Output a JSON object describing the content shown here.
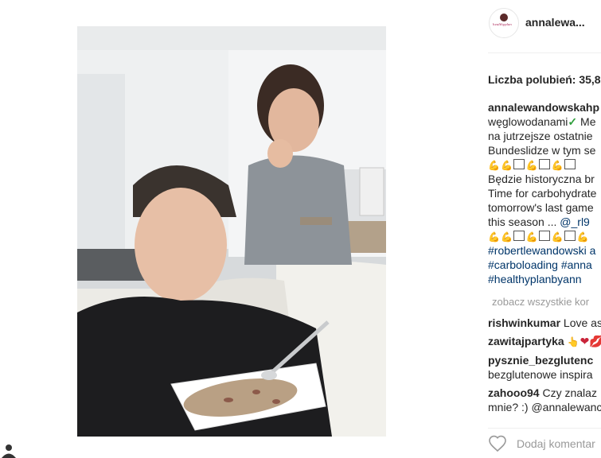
{
  "post": {
    "username": "annalewa...",
    "likes_label": "Liczba polubień: 35,8",
    "caption": {
      "author": "annalewandowskahp",
      "l1b": "węglowodanami",
      "l1c": "Me",
      "l2": "na jutrzejsze ostatnie",
      "l3": "Bundeslidze w tym se",
      "l5": "Będzie historyczna br",
      "l6": "Time for carbohydrate",
      "l7": "tomorrow's last game",
      "l8a": "this season ...",
      "l8b": "@_rl9",
      "l10": "#robertlewandowski a",
      "l11a": "#carboloading",
      "l11b": "#anna",
      "l12": "#healthyplanbyann"
    },
    "see_all_comments": "zobacz wszystkie kor",
    "comments": [
      {
        "user": "rishwinkumar",
        "text": "Love as"
      },
      {
        "user": "zawitajpartyka",
        "text": ""
      },
      {
        "user": "pysznie_bezglutenc",
        "text": "bezglutenowe inspira"
      },
      {
        "user": "zahooo94",
        "text": "Czy znalaz",
        "text2": "mnie? :) @annalewanc"
      }
    ],
    "add_comment_placeholder": "Dodaj komentar",
    "icons": {
      "like": "heart-outline-icon",
      "corner": "person-icon",
      "check": "check-icon"
    }
  }
}
